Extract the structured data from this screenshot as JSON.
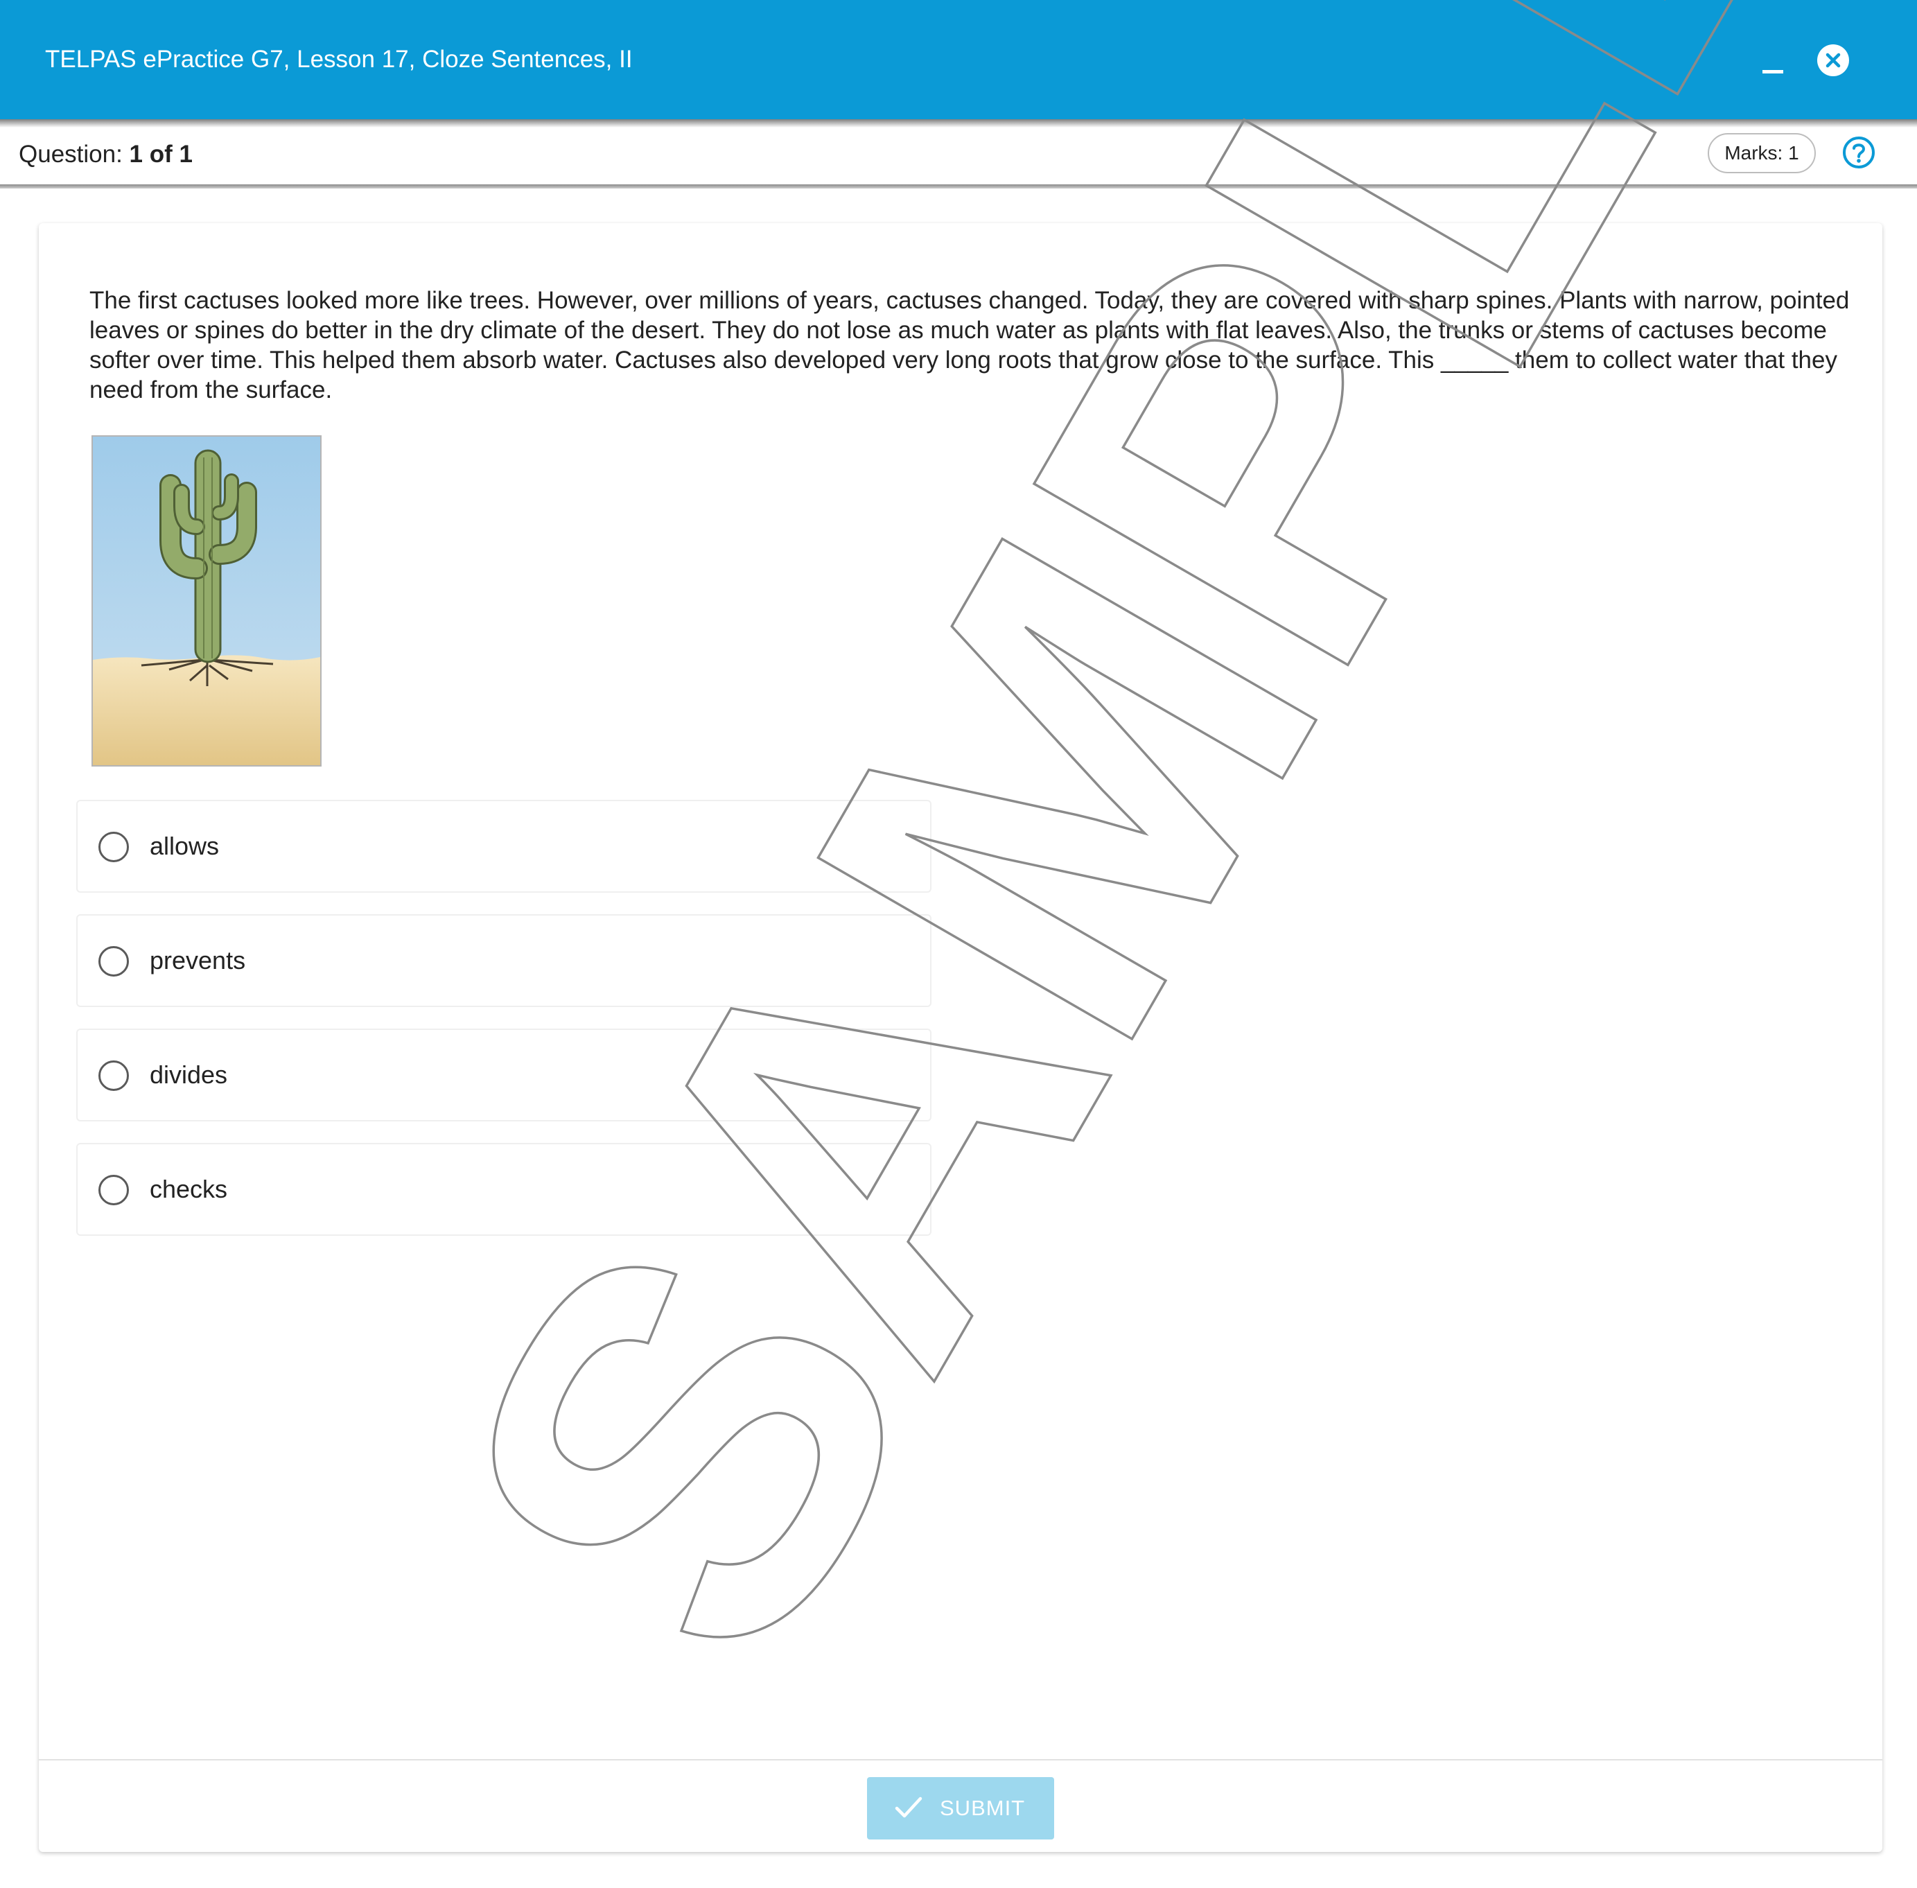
{
  "window": {
    "title": "TELPAS ePractice G7, Lesson 17, Cloze Sentences, II",
    "minimize_icon": "minimize-icon",
    "close_icon": "close-circle-icon"
  },
  "question_bar": {
    "label": "Question:",
    "progress": "1 of 1",
    "marks": "Marks: 1",
    "help_icon": "help-circle-icon"
  },
  "passage": {
    "text": "The first cactuses looked more like trees. However, over millions of years, cactuses changed. Today, they are covered with sharp spines. Plants with narrow, pointed leaves or spines do better in the dry climate of the desert. They do not lose as much water as plants with flat leaves. Also, the trunks or stems of cactuses become softer over time. This helped them absorb water. Cactuses also developed very long roots that grow close to the surface. This _____ them to collect water that they need from the surface."
  },
  "figure": {
    "subject": "saguaro-cactus-illustration"
  },
  "options": [
    {
      "label": "allows"
    },
    {
      "label": "prevents"
    },
    {
      "label": "divides"
    },
    {
      "label": "checks"
    }
  ],
  "submit": {
    "label": "SUBMIT",
    "icon": "checkmark-icon"
  },
  "watermark": {
    "text": "SAMPLE"
  },
  "colors": {
    "titlebar": "#0b9ad6",
    "submit_disabled": "#9dd8ee",
    "help_accent": "#0b9ad6"
  }
}
